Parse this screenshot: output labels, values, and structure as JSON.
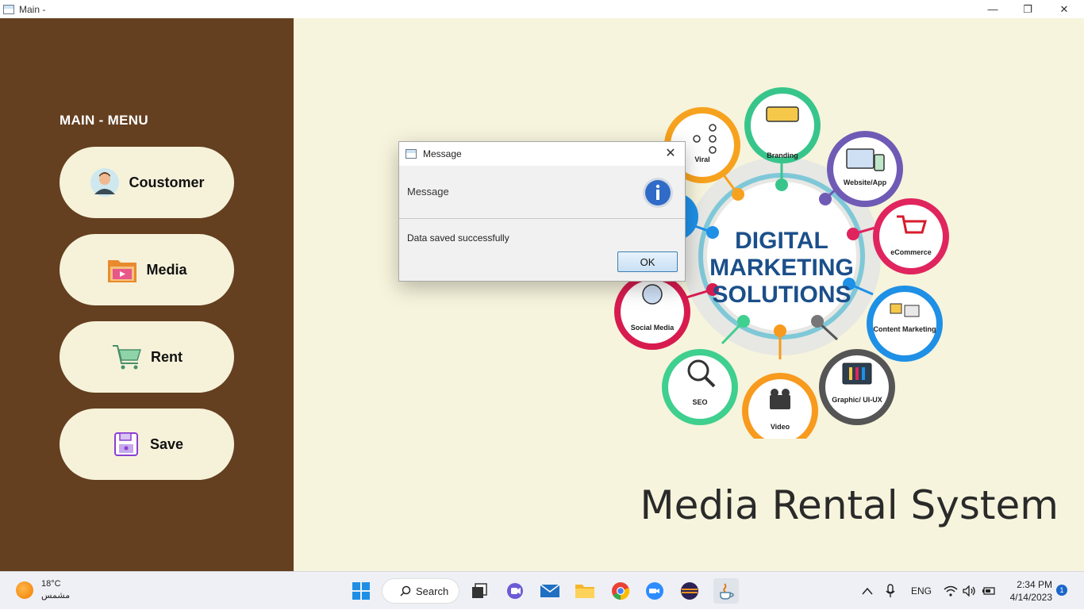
{
  "window": {
    "title": "Main -",
    "minimize_glyph": "—",
    "maximize_glyph": "❐",
    "close_glyph": "✕"
  },
  "sidebar": {
    "heading": "MAIN - MENU",
    "items": [
      {
        "label": "Coustomer",
        "icon": "customer-avatar-icon"
      },
      {
        "label": "Media",
        "icon": "media-folder-icon"
      },
      {
        "label": "Rent",
        "icon": "shopping-cart-icon"
      },
      {
        "label": "Save",
        "icon": "save-disk-icon"
      }
    ],
    "bg_color": "#643f20",
    "button_color": "#f6f2da"
  },
  "main": {
    "bg_color": "#f6f4dc",
    "system_title": "Media Rental System",
    "infographic": {
      "center_lines": [
        "DIGITAL",
        "MARKETING",
        "SOLUTIONS"
      ],
      "nodes": [
        {
          "label": "Branding",
          "color": "#38c58c"
        },
        {
          "label": "Website/App",
          "color": "#6f5bb5"
        },
        {
          "label": "eCommerce",
          "color": "#e0245e"
        },
        {
          "label": "Content Marketing",
          "color": "#1e90e6"
        },
        {
          "label": "Graphic/ UI-UX",
          "color": "#555555"
        },
        {
          "label": "Video",
          "color": "#f79a1e"
        },
        {
          "label": "SEO",
          "color": "#3fcf8e"
        },
        {
          "label": "Social Media",
          "color": "#d81b4f"
        },
        {
          "label": "Viral",
          "color": "#f7a21e"
        }
      ]
    }
  },
  "dialog": {
    "title": "Message",
    "header_text": "Message",
    "message": "Data saved successfully",
    "ok_label": "OK",
    "close_glyph": "✕",
    "icon": "info-icon"
  },
  "taskbar": {
    "weather_temp": "18°C",
    "weather_desc": "مشمس",
    "search_label": "Search",
    "language": "ENG",
    "time": "2:34 PM",
    "date": "4/14/2023",
    "notification_count": "1"
  }
}
